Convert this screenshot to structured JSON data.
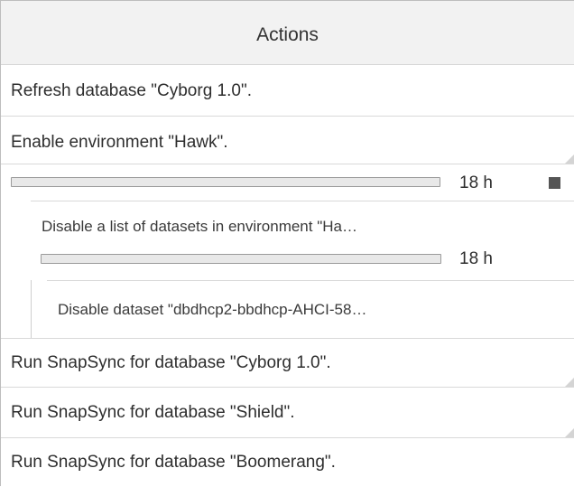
{
  "header": {
    "title": "Actions"
  },
  "actions": [
    {
      "label": "Refresh database \"Cyborg 1.0\"."
    },
    {
      "label": "Enable environment \"Hawk\"."
    },
    {
      "label": "Run SnapSync for database \"Cyborg 1.0\"."
    },
    {
      "label": "Run SnapSync for database \"Shield\"."
    },
    {
      "label": "Run SnapSync for database \"Boomerang\"."
    }
  ],
  "running_task": {
    "progress": 0.0,
    "time_remaining": "18 h",
    "stop_icon": "stop-icon",
    "subtask": {
      "label": "Disable a list of datasets in environment \"Ha…",
      "progress": 0.0,
      "time_remaining": "18 h",
      "subtask": {
        "label": "Disable dataset \"dbdhcp2-bbdhcp-AHCI-58…"
      }
    }
  },
  "colors": {
    "header_bg": "#f2f2f2",
    "row_border": "#d9d9d9",
    "stop_icon": "#555555"
  }
}
